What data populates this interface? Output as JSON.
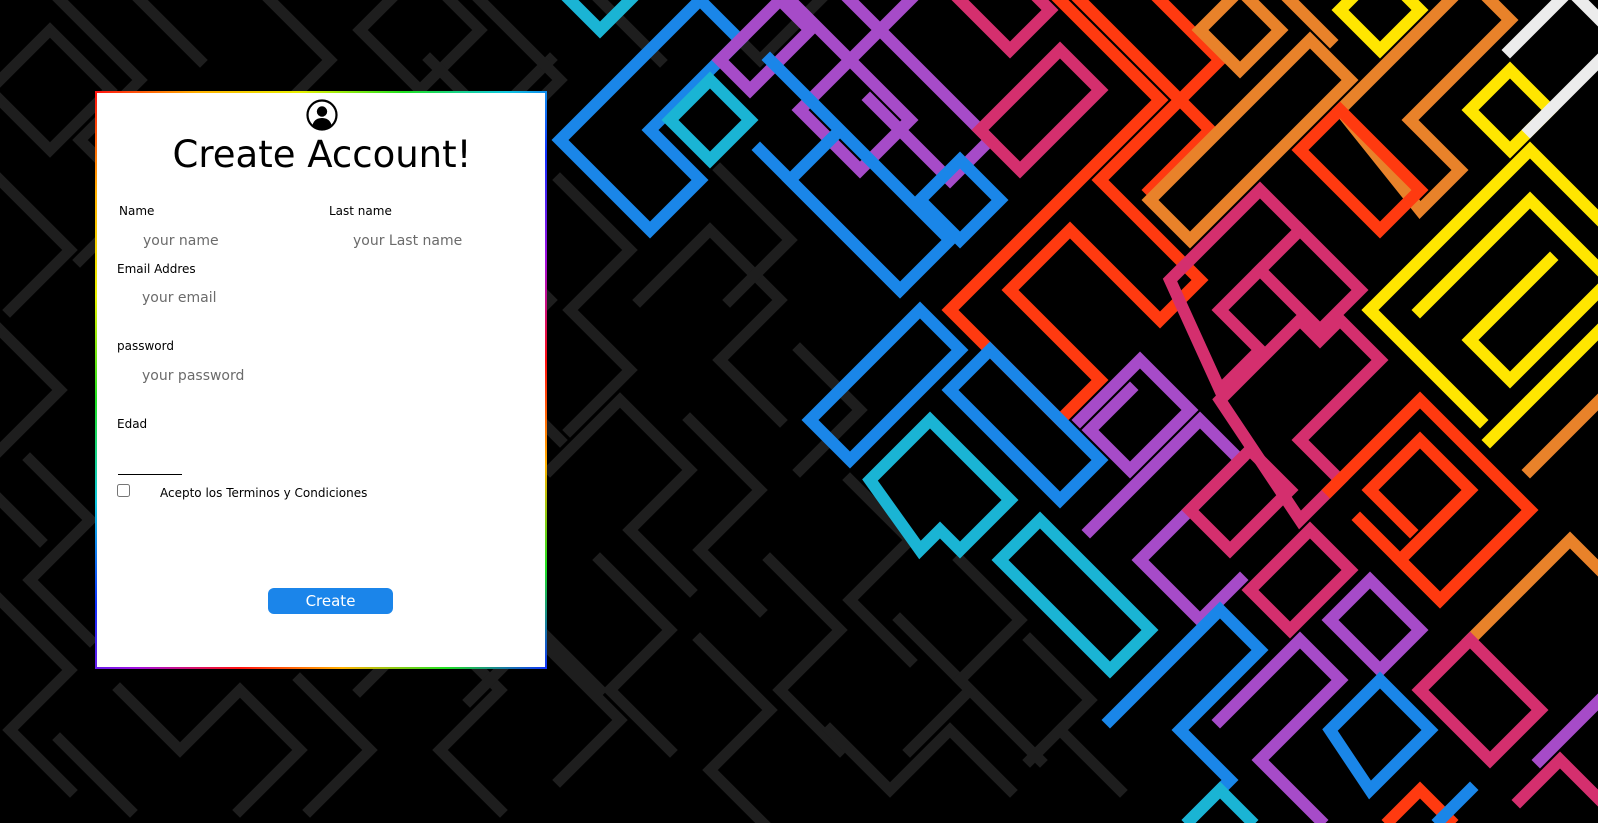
{
  "form": {
    "title": "Create Account!",
    "name_label": "Name",
    "name_placeholder": "your name",
    "lastname_label": "Last name",
    "lastname_placeholder": "your Last name",
    "email_label": "Email Addres",
    "email_placeholder": "your email",
    "password_label": "password",
    "password_placeholder": "your password",
    "age_label": "Edad",
    "terms_label": "Acepto los Terminos y Condiciones",
    "terms_checked": false,
    "submit_label": "Create",
    "avatar_icon": "user-circle-icon"
  },
  "colors": {
    "background": "#000000",
    "pattern_dark": "#1e1e1e",
    "button": "#1b85ea",
    "pattern_palette": [
      "#1a86e8",
      "#1ab4d4",
      "#a64bc8",
      "#d42f6e",
      "#ff3a10",
      "#e8822a",
      "#ffe600",
      "#ececec"
    ]
  }
}
